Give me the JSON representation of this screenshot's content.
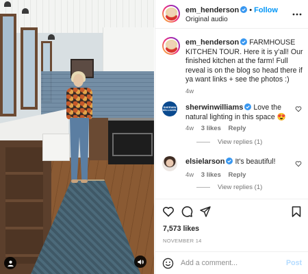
{
  "post": {
    "username": "em_henderson",
    "follow_label": "Follow",
    "separator": "•",
    "audio": "Original audio",
    "caption_user": "em_henderson",
    "caption_text": "FARMHOUSE KITCHEN TOUR. Here it is y’all! Our finished kitchen at the farm! Full reveal is on the blog so head there if ya want links + see the photos :)",
    "caption_time": "4w"
  },
  "comments": [
    {
      "username": "sherwinwilliams",
      "text": "Love the natural lighting in this space 😍",
      "time": "4w",
      "likes": "3 likes",
      "reply": "Reply",
      "view_replies": "View replies (1)",
      "avatar_text": "SHERWIN WILLIAMS."
    },
    {
      "username": "elsielarson",
      "text": "It's beautiful!",
      "time": "4w",
      "likes": "3 likes",
      "reply": "Reply",
      "view_replies": "View replies (1)"
    }
  ],
  "footer": {
    "likes": "7,573 likes",
    "date": "NOVEMBER 14",
    "comment_placeholder": "Add a comment...",
    "post_label": "Post"
  },
  "icons": {
    "like": "heart-icon",
    "comment": "comment-icon",
    "share": "share-icon",
    "save": "bookmark-icon",
    "more": "more-icon",
    "emoji": "emoji-icon",
    "tagged": "user-icon",
    "audio": "speaker-icon",
    "verified": "verified-icon"
  },
  "colors": {
    "link_blue": "#0095f6",
    "post_disabled": "#b3dbff",
    "verified_blue": "#3897f0",
    "muted_text": "#737373"
  }
}
